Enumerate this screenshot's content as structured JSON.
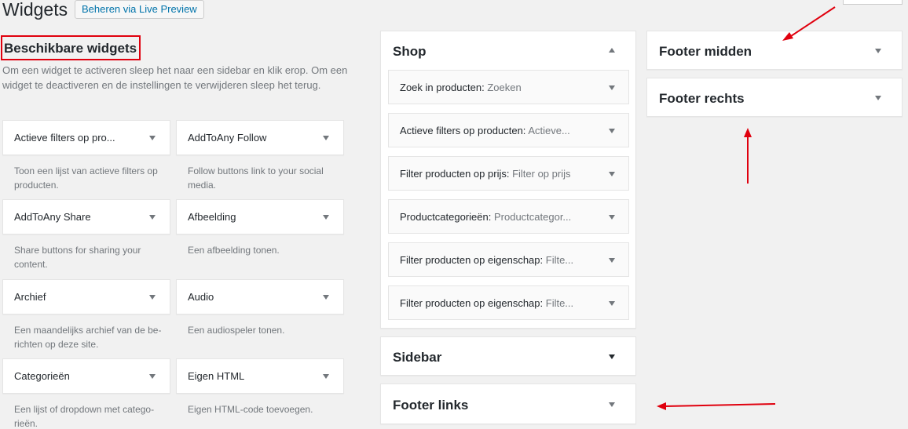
{
  "header": {
    "title": "Widgets",
    "live_preview_label": "Beheren via Live Preview"
  },
  "available": {
    "heading": "Beschikbare widgets",
    "description": "Om een widget te activeren sleep het naar een sidebar en klik erop. Om een widget te deactiveren en de instellingen te verwijderen sleep het terug.",
    "widgets": [
      {
        "title": "Actieve filters op pro...",
        "desc": "Toon een lijst van actieve filters op producten."
      },
      {
        "title": "AddToAny Follow",
        "desc": "Follow buttons link to your social media."
      },
      {
        "title": "AddToAny Share",
        "desc": "Share buttons for sharing your content."
      },
      {
        "title": "Afbeelding",
        "desc": "Een afbeelding tonen."
      },
      {
        "title": "Archief",
        "desc": "Een maandelijks archief van de be-richten op deze site."
      },
      {
        "title": "Audio",
        "desc": "Een audiospeler tonen."
      },
      {
        "title": "Categorieën",
        "desc": "Een lijst of dropdown met catego-rieën."
      },
      {
        "title": "Eigen HTML",
        "desc": "Eigen HTML-code toevoegen."
      }
    ]
  },
  "sidebars": {
    "shop": {
      "title": "Shop",
      "widgets": [
        {
          "name": "Zoek in producten:",
          "sub": "Zoeken"
        },
        {
          "name": "Actieve filters op producten:",
          "sub": "Actieve..."
        },
        {
          "name": "Filter producten op prijs:",
          "sub": "Filter op prijs"
        },
        {
          "name": "Productcategorieën:",
          "sub": "Productcategor..."
        },
        {
          "name": "Filter producten op eigenschap:",
          "sub": "Filte..."
        },
        {
          "name": "Filter producten op eigenschap:",
          "sub": "Filte..."
        }
      ]
    },
    "sidebar": {
      "title": "Sidebar"
    },
    "footer_links": {
      "title": "Footer links"
    },
    "footer_midden": {
      "title": "Footer midden"
    },
    "footer_rechts": {
      "title": "Footer rechts"
    }
  },
  "colors": {
    "annotation_red": "#e0000e",
    "link_blue": "#0073aa",
    "muted_text": "#72777c"
  },
  "icons": {
    "collapse": "triangle-up-icon",
    "expand": "triangle-down-icon"
  }
}
